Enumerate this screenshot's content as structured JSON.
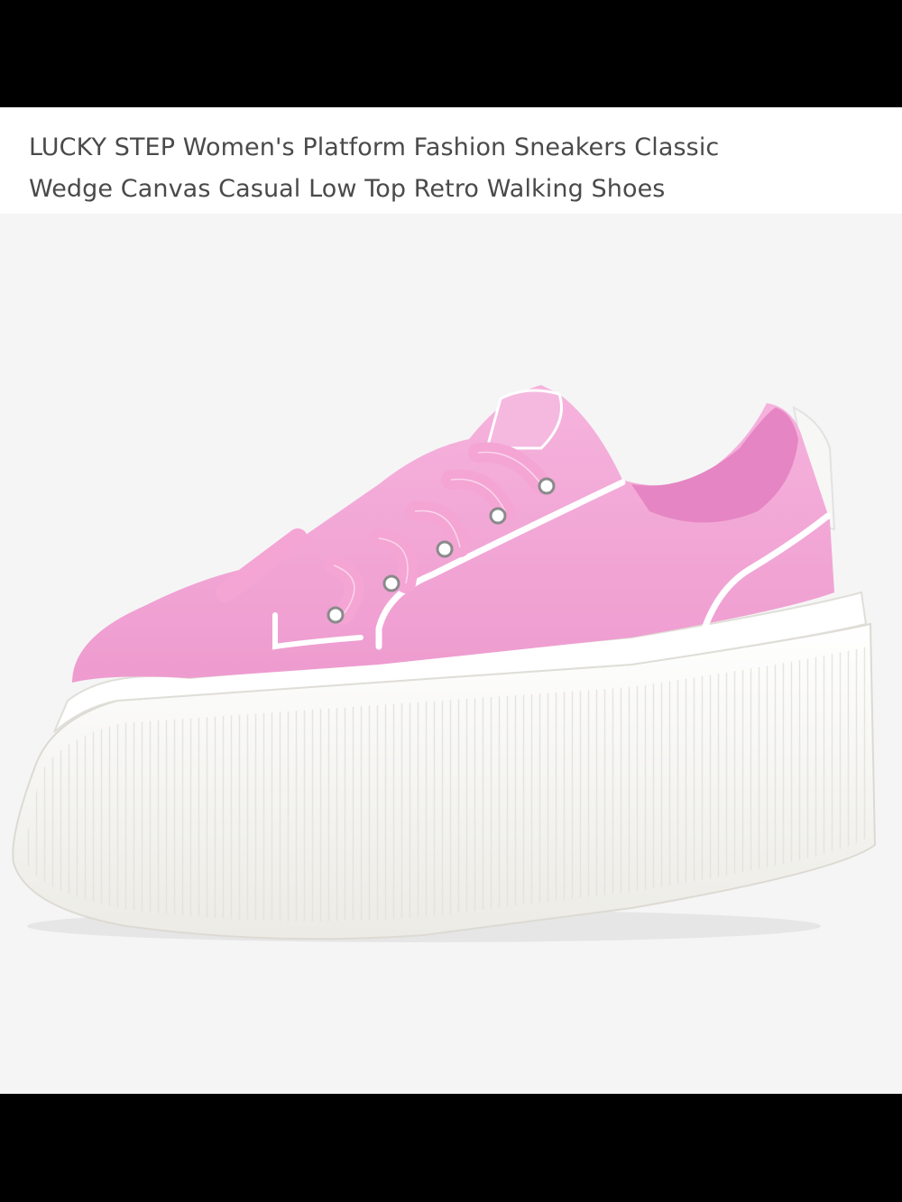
{
  "product": {
    "title_line1": "LUCKY STEP Women's Platform Fashion Sneakers Classic",
    "title_line2": "Wedge Canvas Casual Low Top Retro Walking Shoes",
    "image_icon": "pink-platform-sneaker-photo"
  },
  "colors": {
    "shoe_upper": "#f3a6d6",
    "shoe_sole": "#fafaf6",
    "background": "#f5f5f5",
    "title_text": "#4a4a4a"
  }
}
